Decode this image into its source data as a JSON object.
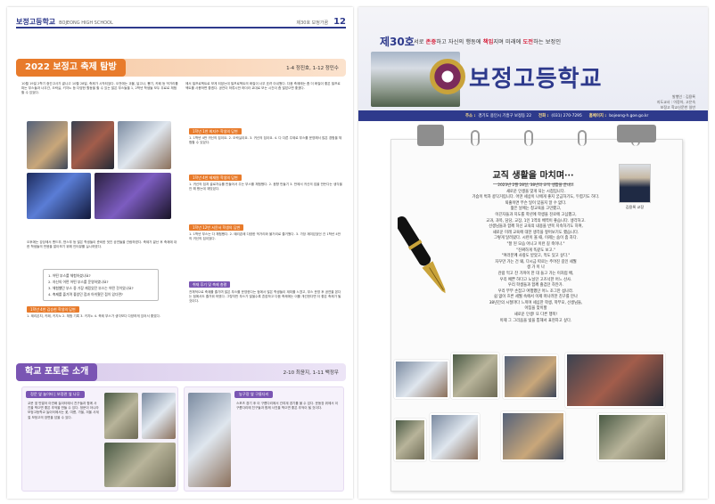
{
  "left_page": {
    "brand": "보정고등학교",
    "brand_en": "BOJEONG HIGH SCHOOL",
    "issue": "제30호 보정가꿈",
    "page_number": "12",
    "festival_section": {
      "title": "2022 보정고 축제 탐방",
      "byline": "1-4 정진호, 1-12 정민수",
      "intro": "10월 19일 2학기 중간고사가 끝나고 10월 28일, 축제가 시작되었다. 오전에는 괴물, 달고나, 뽑기, 카페 등 먹거리를 파는 부스들과 너무간, 오락실, 키자노 등 다양한 활동을 할 수 있는 많은 부스들을 1, 2학년 학생들 모두 무료로 체험할 수 있었다.",
      "col_left_mid": "오후에는 강당에서 밴드부, 댄스부 등 많은 학생들이 준비한 멋진 공연들을 관람하였다. 축제가 끝난 후 축제에 대한 학생들의 반응을 알아보기 위해 인터뷰를 실시하였다.",
      "questions": [
        "1. 어떤 부스를 체험하셨나요?",
        "2. 자신의 어떤 어떤 부스를 운영하였나요?",
        "3. 체험했던 부스 중 가장 재밌었던 부스는 어떤 것이었나요?",
        "4. 축제를 즐기며 좋았던 점과 아쉬웠던 점이 있다면?"
      ],
      "answer_tag_1": "1학년 4반 김승현 학생의 답변",
      "answer_1": "1. 제리온치, 키페, 키지노 2. 체험 기록 3. 키지노 4. 축제 부스가 생각보다 다양하게 있어서 좋았다.",
      "col_right_top": "에서 빌프로젝트로 보게 되었는데 빌프로젝트의 화질이 너무 흐려 아쉬웠다. 다음 축제에는 좀 더 화질이 좋은 빌프로젝트를 사용하면 좋겠다. 공연이 하류시만 하더라 교대로 보는 시간이 좀 많았으면 좋겠다.",
      "answer_tag_2": "1학년 1반 최지수 학생의 답변",
      "answer_2": "1. 1학년 4반 귀신의 집이요. 2. 오락실이요. 3. 귀신의 집이요. 4. 다 다른 주제로 부스를 운영해서 많은 경험을 체험할 수 있었다.",
      "answer_tag_3": "1학년 4반 제재원 학생의 답변",
      "answer_3": "1. 귀신의 집과 골로자슈를 만들어서 주는 부스를 체험했다. 2. 음향 만들기 3. 반에서 귀신의 집을 만든다는 생각을 안 해 봤는데 재밌었다.",
      "answer_tag_4": "1학년 12반 서윤서 학생의 답변",
      "answer_4": "1. 1학년 부스는 다 체험했다. 2. 얘리존에 다양한 먹거리와 볼거리로 즐거웠다. 3. 가장 재미있었던 건 1학년 4반의 귀신의 집이었다.",
      "review_tag": "취재 후기 및 축제 총평",
      "review": "전체적으로 축제를 즐기며 많은 부스를 운영한다는 점에서 많은 학생들이 재미를 느꼈고, 부스 운영 후 공연을 본다는 점에서도 즐거워 하였다. 그렇지만 부스가 많을수록 혼잡하고 다음 축제에는 이를 개선한다면 더 좋은 축제가 될 것이다."
    },
    "school_section": {
      "title": "학교 포토존 소개",
      "byline": "2-10 최윤지, 1-11 백정우",
      "box1_tag": "정문 옆 놀이터 | 보정관 옆 나무",
      "box1_text": "교문 옆 반열어 아연배 놀이터에서 친구들과 함께 사진을 찍으면 좋은 추억을 만들 수 있다. 정문이 아니라 보정고등학교 놀이터에서는 꽃, 여름, 가을, 겨울 사계절 보정고의 장면을 담을 수 있다.",
      "box2_tag": "농구장 옆 구름다리",
      "box2_text": "스포츠 경기 후 이 구름다리에서 관여계 경기를 볼 수 있다. 운동장 위에서 이 구름다리에 친구들과 함께 사진을 찍으면 좋은 추억이 될 것이다."
    }
  },
  "right_page": {
    "issue": "제30호",
    "slogan_prefix": "서로 ",
    "slogan_kw1": "존중",
    "slogan_mid1": "하고 자신의 행동에 ",
    "slogan_kw2": "책임",
    "slogan_mid2": "지며 미래에 ",
    "slogan_kw3": "도전",
    "slogan_suffix": "하는 보정인",
    "school_name": "보정고등학교",
    "staff": [
      "발행인 : 김용록",
      "지도교사 : 이정아, 고은숙",
      "보정고 학교신문반 일반"
    ],
    "address_label": "주소 :",
    "address": "경기도 용인시 기흥구 보정동 22",
    "tel_label": "전화 :",
    "tel": "(031) 270-7295",
    "site_label": "홈페이지 :",
    "site": "bojeong-h.goe.go.kr",
    "letter_title": "교직 생활을 마치며···",
    "principal_caption": "김용록 교장",
    "letter_lines": [
      "2023년 2월 28일, 38년의 교직 생활을 끝내고",
      "새로운 인생을 맞게 되는 시점입니다.",
      "가슴이 벅차 콩닥거립니다. 어떤 세상이 나에게 좋지 궁금하기도, 두렵기도 하다.",
      "퇴출이면 무슨 일이 있을지 알 수 없다.",
      "젊은 날에는 청교육을 고민했고,",
      "이끈자들과 지도를 학년에 학생을 진로에 고심했고,",
      "교과, 과목, 담당, 교장, 1인 1역의 배역이 좋습니다. 생각하고.",
      "선생님들과 함께 하신 교육의 내용을 반복 지속하기도 하며,",
      "새로운 미래 교육에 대한 생각을 짚어보기도 했습니다.",
      "그렇게 달려왔다. 시련이 올 때, 이제는 숨이 좀 차다.",
      "\"잘 된 모습 아니고 이런 길 축이나.\"",
      "\"진짜하게 똑같도 보고.\"",
      "\"여러분께 사랑도 받았고, 먹도 있고 싶다.\"",
      "자꾸만 가는 건 왜, 다시금 따로는 주어진 길인 세월",
      "생 가 이 나",
      "관람 먹고 찬 가까이 한 대 들고 가는 이처럼 배,",
      "우리 예쁜 하다고 노닐던 고즈넉한 어느 산사.",
      "우리 학생들과 함께 즐겁던 하얀가.",
      "우리 부부 손잡고 여행했던 어느 조그만 섬나라.",
      "쉼 없이 흐른 세월 속에서 이제 떠나려한 친구를 만나",
      "38년간의 시절마다 느끼며 세심한 학생, 학부모, 선생님들,",
      "아침을 맞이할",
      "새로운 인생! 또 다른 행복!",
      "이제 그 그리움을 빛을 통해서 표현하고 싶다."
    ]
  },
  "colors": {
    "navy": "#2e3a8c",
    "orange": "#e87b2b",
    "purple": "#7a55b3",
    "red": "#d6203a"
  }
}
